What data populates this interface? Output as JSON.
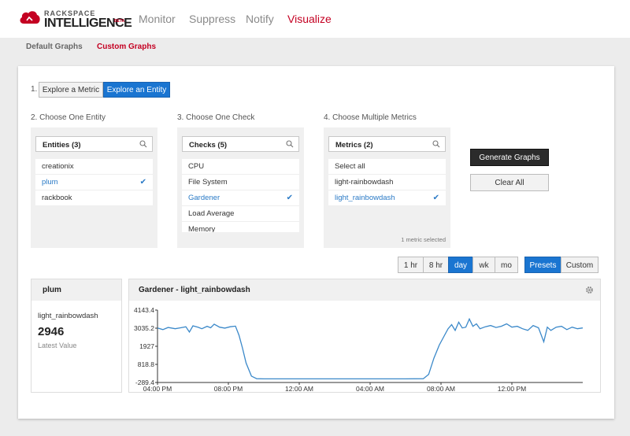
{
  "app": {
    "logo_top": "RACKSPACE",
    "logo_main": "INTELLIGENCE",
    "logo_beta": "BETA",
    "nav": [
      {
        "label": "Monitor",
        "active": false
      },
      {
        "label": "Suppress",
        "active": false
      },
      {
        "label": "Notify",
        "active": false
      },
      {
        "label": "Visualize",
        "active": true
      }
    ],
    "subtabs": [
      {
        "label": "Default Graphs",
        "active": false
      },
      {
        "label": "Custom Graphs",
        "active": true
      }
    ],
    "accent_color": "#c40022",
    "primary_color": "#1a75d1"
  },
  "step1": {
    "prefix": "1.",
    "options": [
      {
        "label": "Explore a Metric",
        "active": false
      },
      {
        "label": "Explore an Entity",
        "active": true
      }
    ]
  },
  "columns": [
    {
      "heading": "2. Choose One Entity",
      "search_label": "Entities (3)",
      "items": [
        {
          "label": "creationix",
          "selected": false
        },
        {
          "label": "plum",
          "selected": true
        },
        {
          "label": "rackbook",
          "selected": false
        }
      ]
    },
    {
      "heading": "3. Choose One Check",
      "search_label": "Checks (5)",
      "items": [
        {
          "label": "CPU",
          "selected": false
        },
        {
          "label": "File System",
          "selected": false
        },
        {
          "label": "Gardener",
          "selected": true
        },
        {
          "label": "Load Average",
          "selected": false
        },
        {
          "label": "Memory",
          "selected": false
        }
      ]
    },
    {
      "heading": "4. Choose Multiple Metrics",
      "search_label": "Metrics (2)",
      "items": [
        {
          "label": "Select all",
          "selected": false
        },
        {
          "label": "light-rainbowdash",
          "selected": false
        },
        {
          "label": "light_rainbowdash",
          "selected": true
        }
      ],
      "selection_info": "1 metric selected"
    }
  ],
  "actions": {
    "generate": "Generate Graphs",
    "clear": "Clear All"
  },
  "time_ranges": [
    {
      "label": "1 hr",
      "active": false
    },
    {
      "label": "8 hr",
      "active": false
    },
    {
      "label": "day",
      "active": true
    },
    {
      "label": "wk",
      "active": false
    },
    {
      "label": "mo",
      "active": false
    }
  ],
  "view_modes": [
    {
      "label": "Presets",
      "active": true
    },
    {
      "label": "Custom",
      "active": false
    }
  ],
  "latest": {
    "entity": "plum",
    "metric": "light_rainbowdash",
    "value": "2946",
    "caption": "Latest Value"
  },
  "graph": {
    "title": "Gardener - light_rainbowdash"
  },
  "chart_data": {
    "type": "line",
    "title": "Gardener - light_rainbowdash",
    "yticks": [
      "4143.4",
      "3035.2",
      "1927",
      "818.8",
      "-289.4"
    ],
    "ylim": [
      -289.4,
      4143.4
    ],
    "xticks": [
      "04:00 PM",
      "08:00 PM",
      "12:00 AM",
      "04:00 AM",
      "08:00 AM",
      "12:00 PM"
    ],
    "xlim": [
      0,
      24
    ],
    "grid": false,
    "line_color": "#3a88c9",
    "series": [
      {
        "x": [
          0,
          0.3,
          0.6,
          1.0,
          1.3,
          1.6,
          1.8,
          2.0,
          2.3,
          2.5,
          2.8,
          3.0,
          3.2,
          3.5,
          3.8,
          4.1,
          4.4,
          4.6,
          4.8,
          5.0,
          5.3,
          5.6,
          6,
          8,
          10,
          12,
          14,
          15,
          15.3,
          15.6,
          15.9,
          16.2,
          16.4,
          16.6,
          16.8,
          17.0,
          17.2,
          17.4,
          17.6,
          17.8,
          18.0,
          18.2,
          18.5,
          18.8,
          19.1,
          19.4,
          19.7,
          20.0,
          20.3,
          20.6,
          20.9,
          21.2,
          21.5,
          21.8,
          22.0,
          22.2,
          22.5,
          22.8,
          23.1,
          23.4,
          23.7,
          24
        ],
        "y": [
          3050,
          2950,
          3080,
          3000,
          3060,
          3120,
          2800,
          3180,
          3090,
          3000,
          3150,
          3060,
          3280,
          3100,
          3040,
          3120,
          3160,
          2600,
          1800,
          900,
          100,
          -60,
          -70,
          -70,
          -70,
          -70,
          -70,
          -60,
          200,
          1200,
          2000,
          2600,
          3000,
          3250,
          2900,
          3400,
          3050,
          3100,
          3600,
          3150,
          3300,
          3000,
          3120,
          3200,
          3080,
          3150,
          3300,
          3100,
          3150,
          3000,
          2900,
          3200,
          3060,
          2200,
          3100,
          2900,
          3100,
          3150,
          2950,
          3100,
          3000,
          3050
        ]
      }
    ]
  }
}
